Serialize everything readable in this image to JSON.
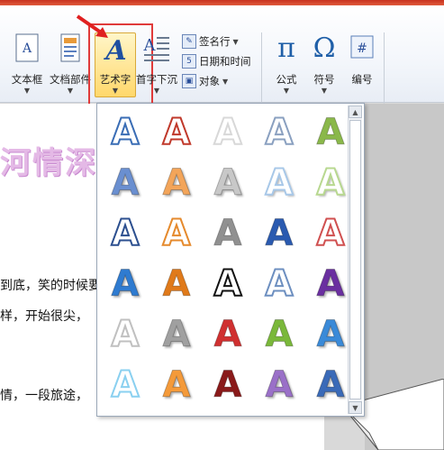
{
  "ribbon": {
    "buttons": {
      "textbox": "文本框",
      "quickparts": "文档部件",
      "wordart": "艺术字",
      "dropcap": "首字下沉",
      "equation": "公式",
      "symbol": "符号",
      "numbering": "编号"
    },
    "small": {
      "signature": "签名行",
      "datetime": "日期和时间",
      "object": "对象"
    },
    "glyphs": {
      "equation": "π",
      "symbol": "Ω",
      "numbering": "#"
    }
  },
  "document": {
    "heading": "河情深",
    "lines": [
      "到底，笑的时候要",
      "样，开始很尖，",
      "情，一段旅途，"
    ]
  },
  "gallery": {
    "letter": "A",
    "styles": [
      [
        "outline-blue",
        "outline-red",
        "outline-light",
        "outline-steel",
        "green-fill"
      ],
      [
        "blue-bevel",
        "orange-bevel",
        "gray-bevel",
        "lightblue-bevel",
        "lightgreen-bevel"
      ],
      [
        "navy-outline",
        "orange-outline",
        "silver-gradient",
        "blue-solid",
        "red-outline"
      ],
      [
        "blue-reflect",
        "orange-solid",
        "black-outline",
        "blue-outline",
        "purple-reflect"
      ],
      [
        "white-gray",
        "silver-shadow",
        "red-gradient",
        "green-gradient",
        "blue-reflect-2"
      ],
      [
        "sky-outline",
        "orange-glow",
        "darkred-solid",
        "purple-glow",
        "blue-3d"
      ]
    ],
    "colors": {
      "outline-blue": "#3a6db5",
      "outline-red": "#c0392b",
      "outline-light": "#d8d8d8",
      "outline-steel": "#8aa0c0",
      "green-fill": "#8ab84a",
      "blue-bevel": "#6a8fd0",
      "orange-bevel": "#f3a55a",
      "gray-bevel": "#c8c8c8",
      "lightblue-bevel": "#a8c8e8",
      "lightgreen-bevel": "#b8d890",
      "navy-outline": "#2c4f8f",
      "orange-outline": "#e58a2d",
      "silver-gradient": "#909090",
      "blue-solid": "#2a5ab0",
      "red-outline": "#d05050",
      "blue-reflect": "#2f7bd0",
      "orange-solid": "#e07a1a",
      "black-outline": "#111111",
      "blue-outline": "#6d8fc0",
      "purple-reflect": "#6a2fa0",
      "white-gray": "#c0c0c0",
      "silver-shadow": "#a0a0a0",
      "red-gradient": "#d03030",
      "green-gradient": "#7ab83a",
      "blue-reflect-2": "#3a8ad8",
      "sky-outline": "#8ad0f0",
      "orange-glow": "#f49a3a",
      "darkred-solid": "#8a1a1a",
      "purple-glow": "#9a70c8",
      "blue-3d": "#3a6ab8"
    }
  }
}
